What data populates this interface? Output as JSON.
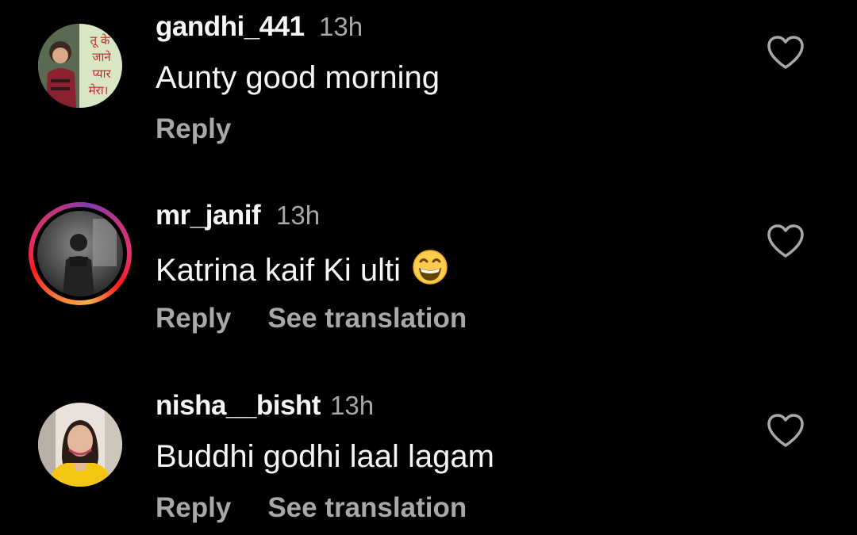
{
  "comments": [
    {
      "username": "gandhi_441",
      "time": "13h",
      "text": "Aunty good morning",
      "emoji": "",
      "avatar_text": [
        "तू के",
        "जाने",
        "प्यार",
        "मेरा।"
      ],
      "reply_label": "Reply",
      "translate_label": "",
      "like_icon": "heart-outline-icon"
    },
    {
      "username": "mr_janif",
      "time": "13h",
      "text": "Katrina kaif Ki ulti",
      "emoji": "grinning-face-icon",
      "reply_label": "Reply",
      "translate_label": "See translation",
      "like_icon": "heart-outline-icon"
    },
    {
      "username": "nisha__bisht",
      "time": "13h",
      "text": "Buddhi godhi laal lagam",
      "emoji": "",
      "reply_label": "Reply",
      "translate_label": "See translation",
      "like_icon": "heart-outline-icon"
    }
  ],
  "colors": {
    "background": "#000000",
    "primary_text": "#f5f5f5",
    "secondary_text": "#a8a8a8",
    "story_ring_start": "#f77737",
    "story_ring_end": "#c13584"
  }
}
